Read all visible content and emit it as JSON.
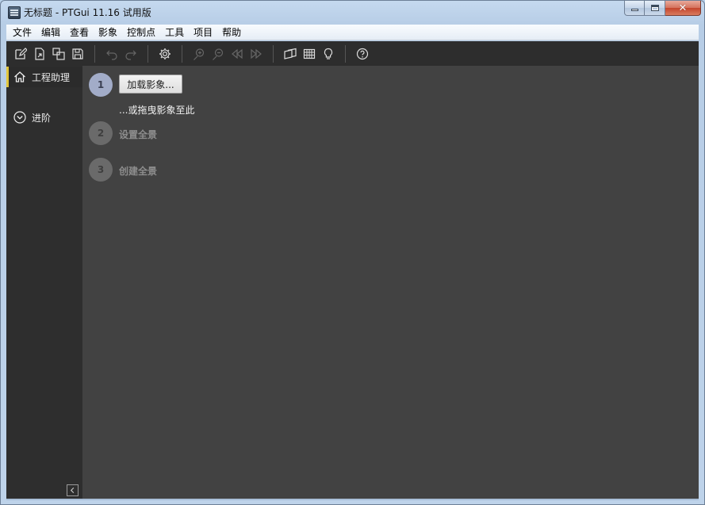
{
  "window": {
    "title": "无标题 - PTGui 11.16 试用版"
  },
  "menu": {
    "items": [
      "文件",
      "编辑",
      "查看",
      "影象",
      "控制点",
      "工具",
      "项目",
      "帮助"
    ]
  },
  "toolbar": {
    "groups": [
      [
        "new-project-icon",
        "open-project-icon",
        "copy-project-icon",
        "save-icon"
      ],
      [
        "undo-icon",
        "redo-icon"
      ],
      [
        "settings-gear-icon"
      ],
      [
        "zoom-in-icon",
        "zoom-out-icon",
        "previous-icon",
        "next-icon"
      ],
      [
        "panorama-editor-icon",
        "control-point-table-icon",
        "lightbulb-icon"
      ],
      [
        "help-icon"
      ]
    ]
  },
  "sidebar": {
    "items": [
      {
        "label": "工程助理",
        "icon": "home-icon",
        "active": true
      },
      {
        "label": "进阶",
        "icon": "chevron-circle-down-icon",
        "active": false
      }
    ],
    "collapse_icon": "chevron-left-icon"
  },
  "steps": [
    {
      "number": "1",
      "button_label": "加载影象...",
      "hint": "...或拖曳影象至此",
      "active": true
    },
    {
      "number": "2",
      "label": "设置全景",
      "active": false
    },
    {
      "number": "3",
      "label": "创建全景",
      "active": false
    }
  ],
  "colors": {
    "accent": "#e3c63b",
    "active_step": "#a2acc8",
    "inactive_step": "#6a6a6a",
    "main_bg": "#424242",
    "sidebar_bg": "#2e2e2e",
    "toolbar_bg": "#2d2d2d"
  }
}
